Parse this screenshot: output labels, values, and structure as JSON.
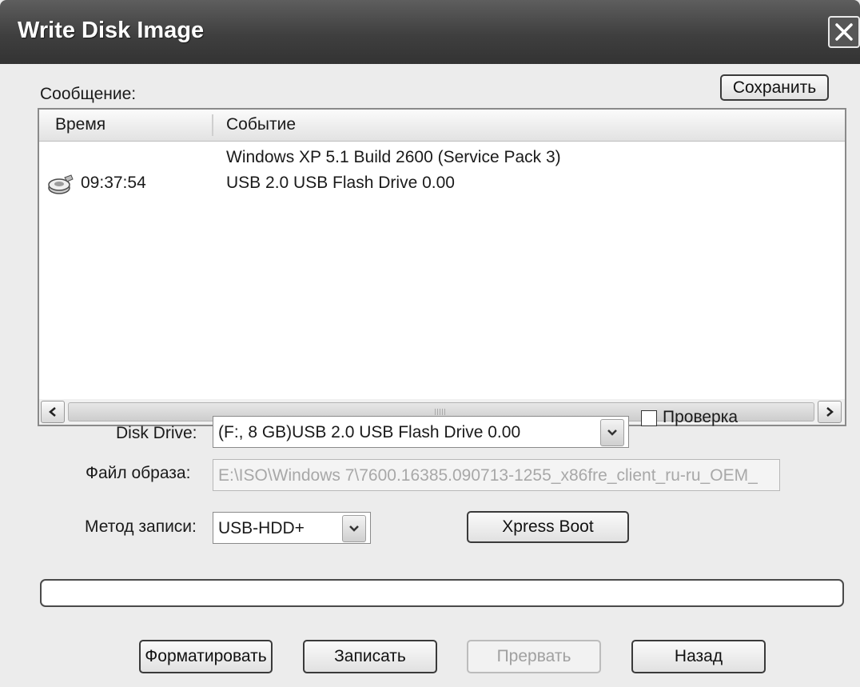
{
  "window": {
    "title": "Write Disk Image"
  },
  "log": {
    "label": "Сообщение:",
    "save_button": "Сохранить",
    "columns": {
      "time": "Время",
      "event": "Событие"
    },
    "rows": [
      {
        "time": "",
        "event": "Windows XP 5.1 Build 2600 (Service Pack 3)",
        "icon": ""
      },
      {
        "time": "09:37:54",
        "event": "USB 2.0 USB Flash Drive 0.00",
        "icon": "usb-drive-icon"
      }
    ]
  },
  "form": {
    "disk_drive_label": "Disk Drive:",
    "disk_drive_value": "(F:, 8 GB)USB 2.0 USB Flash Drive 0.00",
    "verify_label": "Проверка",
    "verify_checked": false,
    "image_file_label": "Файл образа:",
    "image_file_value": "E:\\ISO\\Windows 7\\7600.16385.090713-1255_x86fre_client_ru-ru_OEM_",
    "write_method_label": "Метод записи:",
    "write_method_value": "USB-HDD+",
    "xpress_boot_button": "Xpress Boot"
  },
  "progress": {
    "value": 0
  },
  "actions": {
    "format_button": "Форматировать",
    "write_button": "Записать",
    "abort_button": "Прервать",
    "back_button": "Назад"
  }
}
